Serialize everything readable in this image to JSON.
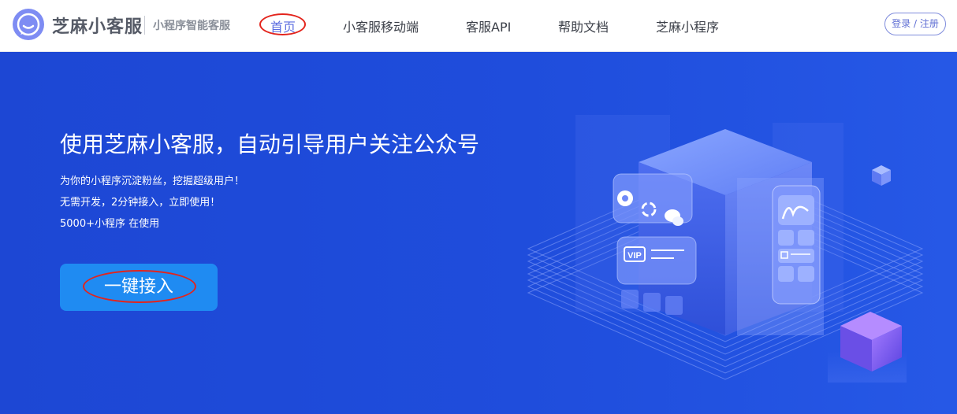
{
  "header": {
    "brand": "芝麻小客服",
    "slogan": "小程序智能客服",
    "nav": [
      "首页",
      "小客服移动端",
      "客服API",
      "帮助文档",
      "芝麻小程序"
    ],
    "login": "登录 / 注册"
  },
  "hero": {
    "title": "使用芝麻小客服，自动引导用户关注公众号",
    "lines": [
      "为你的小程序沉淀粉丝，挖掘超级用户！",
      "无需开发，2分钟接入，立即使用！",
      "5000+小程序 在使用"
    ],
    "cta": "一键接入",
    "vip_text": "VIP"
  },
  "colors": {
    "accent": "#5b6de0",
    "hero_bg": "#1e4bd6",
    "cta_bg": "#1f8bf2",
    "annotation": "#e3241c"
  },
  "icons": [
    "chat-bubble-logo-icon",
    "aperture-icon",
    "refresh-icon",
    "wechat-icon",
    "chart-icon"
  ]
}
